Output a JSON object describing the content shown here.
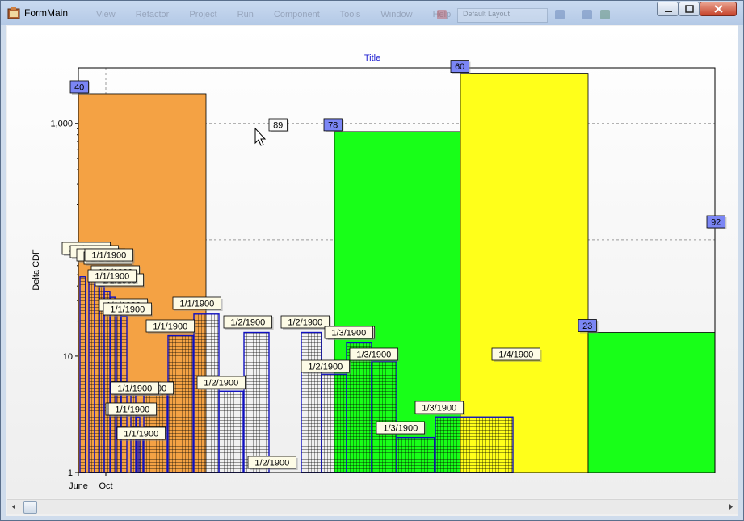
{
  "window": {
    "title": "FormMain",
    "ghost_menu": [
      "View",
      "Refactor",
      "Project",
      "Run",
      "Component",
      "Tools",
      "Window",
      "Help"
    ],
    "ghost_box": "Default Layout"
  },
  "chart_data": {
    "type": "bar",
    "title": "Title",
    "ylabel": "Delta CDF",
    "xlabel": "",
    "y_scale": "log",
    "ylim": [
      1,
      3000
    ],
    "yticks": [
      "1",
      "10",
      "1,000"
    ],
    "xticks": [
      "June",
      "Oct"
    ],
    "grid": true,
    "bars": [
      {
        "color": "#f4a244",
        "fill": "solid",
        "value": 1800,
        "label": "40"
      },
      {
        "color": "#18ff18",
        "fill": "solid",
        "value": 850,
        "label": "78"
      },
      {
        "color": "#ffff1a",
        "fill": "solid",
        "value": 2700,
        "label": "60"
      },
      {
        "color": "#18ff18",
        "fill": "solid",
        "value": 16,
        "label": "23"
      }
    ],
    "annotations": [
      "89",
      "92"
    ],
    "hatched_bars": [
      {
        "color": "#e8c34a",
        "value": 48,
        "label": "1/1/1900"
      },
      {
        "color": "#1414c8",
        "value": 45,
        "label": "1/1/1900"
      },
      {
        "color": "#1414c8",
        "value": 42,
        "label": "1/1/1900"
      },
      {
        "color": "#1414c8",
        "value": 40,
        "label": "1/1/1900"
      },
      {
        "color": "#1414c8",
        "value": 36,
        "label": "1/1/1900"
      },
      {
        "color": "#1414c8",
        "value": 32,
        "label": "1/1/1900"
      },
      {
        "color": "#1414c8",
        "value": 28,
        "label": "1/1/1900"
      },
      {
        "color": "#1414c8",
        "value": 22,
        "label": "1/1/1900"
      },
      {
        "color": "#1414c8",
        "value": 5,
        "label": "1/1/1900"
      },
      {
        "color": "#1414c8",
        "value": 3,
        "label": "1/1/1900"
      },
      {
        "color": "#1414c8",
        "value": 2,
        "label": "1/1/1900"
      },
      {
        "color": "#f0a040",
        "value": 5,
        "label": "1/1/1900"
      },
      {
        "color": "#d83a1a",
        "value": 15,
        "label": "1/1/1900"
      },
      {
        "color": "#10807a",
        "value": 23,
        "label": "1/1/1900"
      },
      {
        "color": "#203050",
        "value": 5,
        "label": "1/2/1900"
      },
      {
        "color": "#10807a",
        "value": 16,
        "label": "1/2/1900"
      },
      {
        "color": "#e8c34a",
        "value": 16,
        "label": "1/2/1900"
      },
      {
        "color": "#10807a",
        "value": 7,
        "label": "1/2/1900"
      },
      {
        "color": "#606070",
        "value": 13,
        "label": "1/3/1900"
      },
      {
        "color": "#e8c34a",
        "value": 9,
        "label": "1/3/1900"
      },
      {
        "color": "#a0a0b8",
        "value": 2,
        "label": "1/3/1900"
      },
      {
        "color": "#203070",
        "value": 3,
        "label": "1/3/1900"
      }
    ],
    "extra_labels": [
      "1/1/1900",
      "1/1/1900",
      "1/1/1900",
      "1/1/1900",
      "1/2/1900",
      "1/3/1900",
      "1/4/1900"
    ]
  }
}
